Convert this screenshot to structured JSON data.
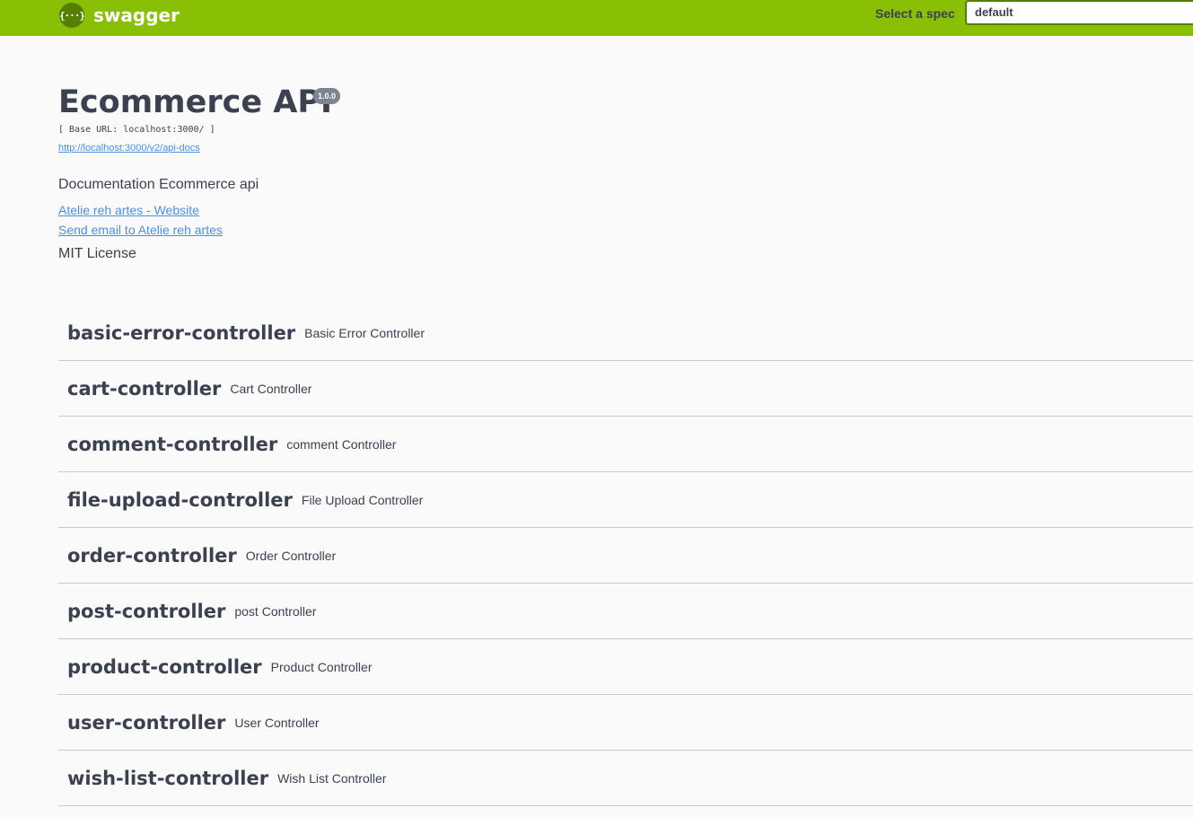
{
  "topbar": {
    "logo_icon": "{···}",
    "logo_text": "swagger",
    "spec_label": "Select a spec",
    "spec_value": "default",
    "colors": {
      "background": "#89bf04",
      "accent": "#547f00"
    }
  },
  "info": {
    "title": "Ecommerce API",
    "version": "1.0.0",
    "base_url": "[ Base URL: localhost:3000/ ]",
    "docs_url": "http://localhost:3000/v2/api-docs",
    "description": "Documentation Ecommerce api",
    "website_link": "Atelie reh artes - Website",
    "email_link": "Send email to Atelie reh artes",
    "license": "MIT License"
  },
  "tags": [
    {
      "name": "basic-error-controller",
      "description": "Basic Error Controller"
    },
    {
      "name": "cart-controller",
      "description": "Cart Controller"
    },
    {
      "name": "comment-controller",
      "description": "comment Controller"
    },
    {
      "name": "file-upload-controller",
      "description": "File Upload Controller"
    },
    {
      "name": "order-controller",
      "description": "Order Controller"
    },
    {
      "name": "post-controller",
      "description": "post Controller"
    },
    {
      "name": "product-controller",
      "description": "Product Controller"
    },
    {
      "name": "user-controller",
      "description": "User Controller"
    },
    {
      "name": "wish-list-controller",
      "description": "Wish List Controller"
    }
  ]
}
